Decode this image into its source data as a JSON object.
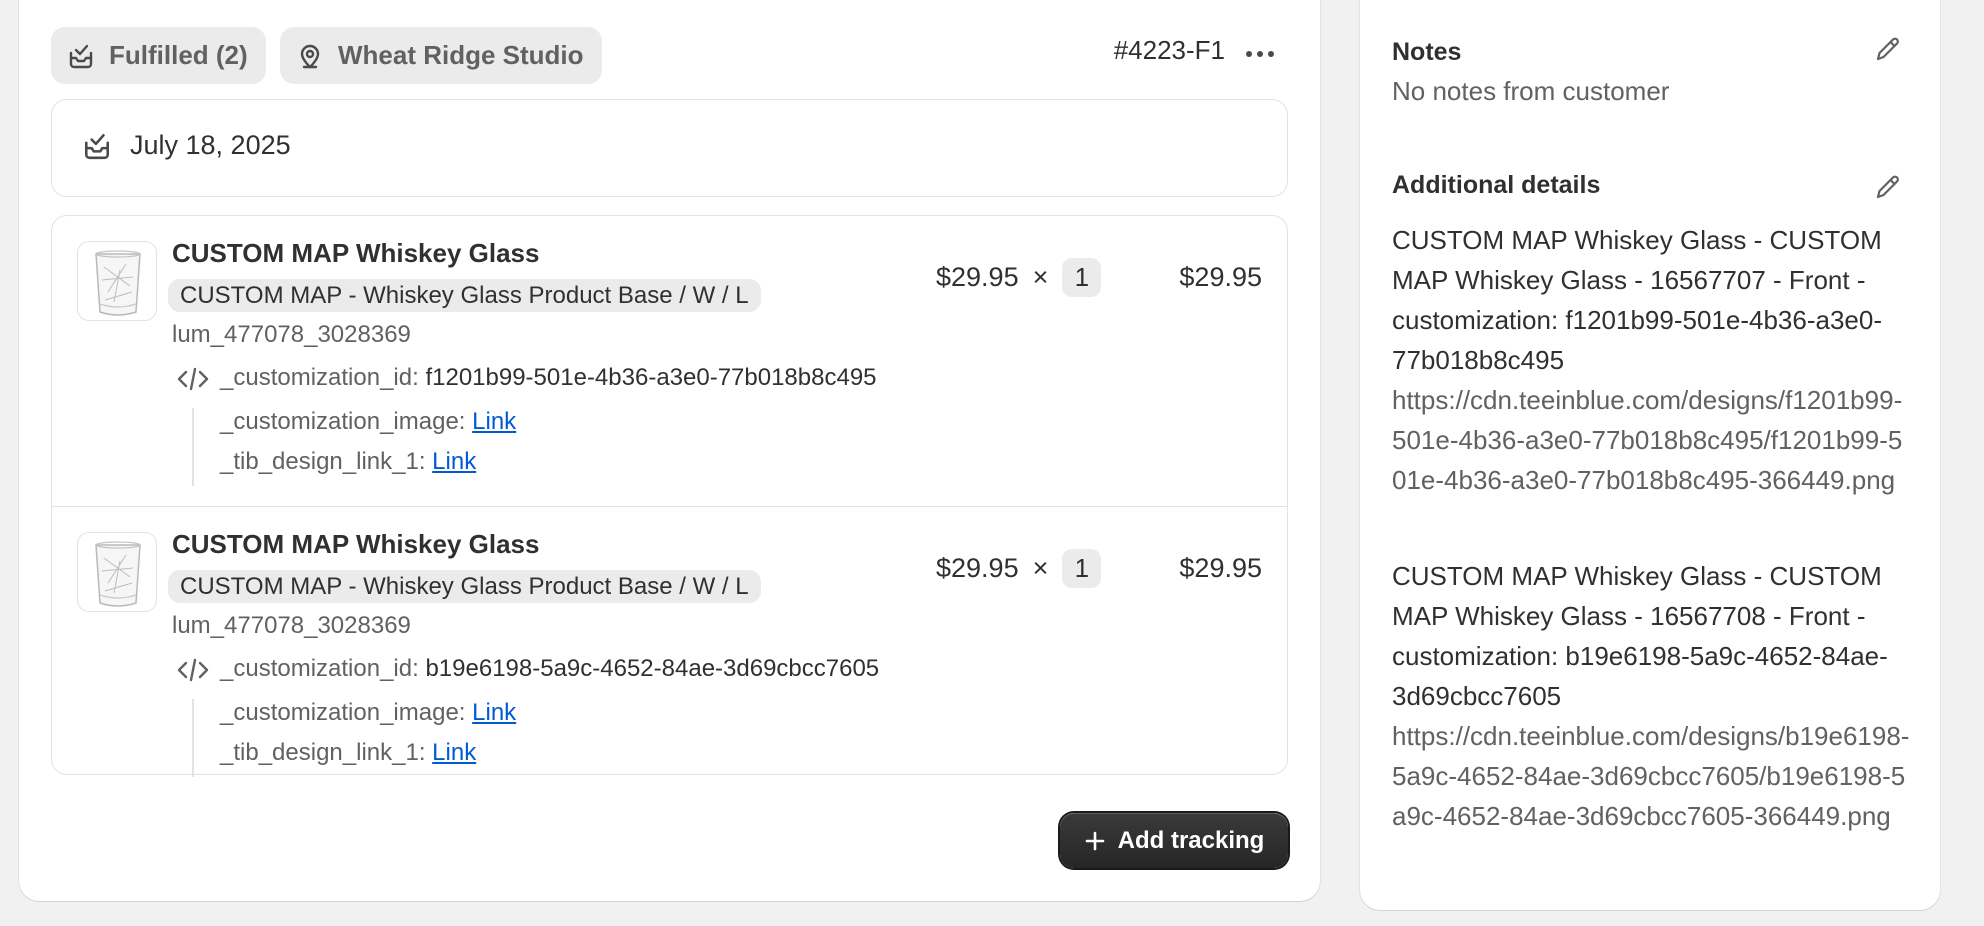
{
  "fulfillment": {
    "status_label": "Fulfilled (2)",
    "location_label": "Wheat Ridge Studio",
    "number": "#4223-F1",
    "date": "July 18, 2025"
  },
  "items": [
    {
      "title": "CUSTOM MAP Whiskey Glass",
      "variant": "CUSTOM MAP - Whiskey Glass Product Base / W / L",
      "sku": "lum_477078_3028369",
      "customization_id_label": "_customization_id:",
      "customization_id": "f1201b99-501e-4b36-a3e0-77b018b8c495",
      "customization_image_label": "_customization_image:",
      "design_link_label": "_tib_design_link_1:",
      "link_text": "Link",
      "price": "$29.95",
      "times": "×",
      "quantity": "1",
      "total": "$29.95"
    },
    {
      "title": "CUSTOM MAP Whiskey Glass",
      "variant": "CUSTOM MAP - Whiskey Glass Product Base / W / L",
      "sku": "lum_477078_3028369",
      "customization_id_label": "_customization_id:",
      "customization_id": "b19e6198-5a9c-4652-84ae-3d69cbcc7605",
      "customization_image_label": "_customization_image:",
      "design_link_label": "_tib_design_link_1:",
      "link_text": "Link",
      "price": "$29.95",
      "times": "×",
      "quantity": "1",
      "total": "$29.95"
    }
  ],
  "actions": {
    "add_tracking": "Add tracking"
  },
  "notes": {
    "title": "Notes",
    "empty": "No notes from customer"
  },
  "additional_details": {
    "title": "Additional details",
    "entries": [
      {
        "text": "CUSTOM MAP Whiskey Glass - CUSTOM MAP Whiskey Glass - 16567707 - Front - customization: f1201b99-501e-4b36-a3e0-77b018b8c495",
        "url": "https://cdn.teeinblue.com/designs/f1201b99-501e-4b36-a3e0-77b018b8c495/f1201b99-501e-4b36-a3e0-77b018b8c495-366449.png"
      },
      {
        "text": "CUSTOM MAP Whiskey Glass - CUSTOM MAP Whiskey Glass - 16567708 - Front - customization: b19e6198-5a9c-4652-84ae-3d69cbcc7605",
        "url": "https://cdn.teeinblue.com/designs/b19e6198-5a9c-4652-84ae-3d69cbcc7605/b19e6198-5a9c-4652-84ae-3d69cbcc7605-366449.png"
      }
    ]
  },
  "icons": {
    "status": "fulfilled-icon",
    "location": "location-pin-icon",
    "more": "more-horizontal-icon",
    "code": "code-icon",
    "edit": "pencil-icon",
    "plus": "plus-icon"
  },
  "colors": {
    "link": "#005bd3",
    "primary_button": "#303030",
    "pill_bg": "#ebebeb"
  }
}
